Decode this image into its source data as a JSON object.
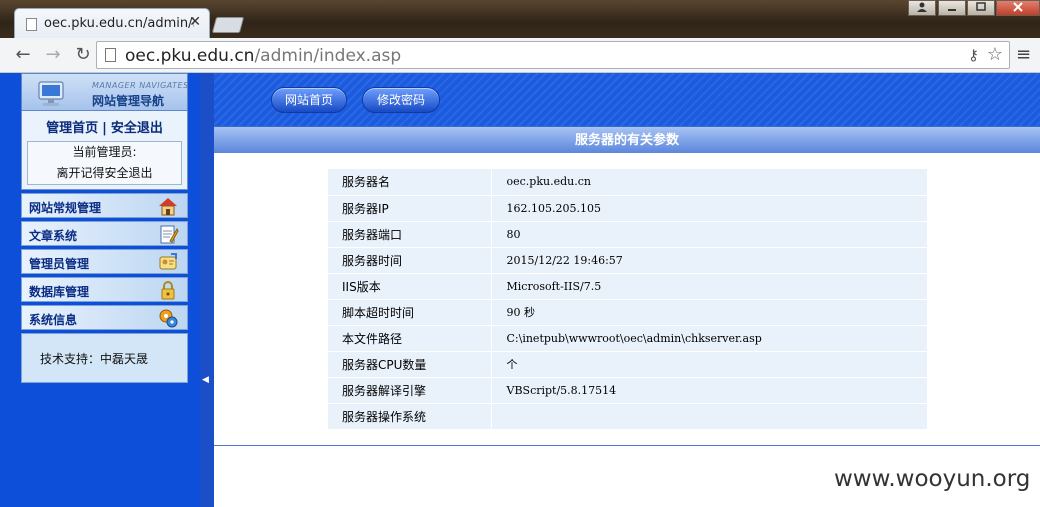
{
  "browser": {
    "tab_title": "oec.pku.edu.cn/admin/i",
    "tab_close": "✕",
    "url_host": "oec.pku.edu.cn",
    "url_path": "/admin/index.asp"
  },
  "sidebar": {
    "nav_subtitle": "MANAGER NAVIGATES",
    "nav_title": "网站管理导航",
    "links": {
      "home": "管理首页",
      "separator": "|",
      "logout": "安全退出"
    },
    "admin_label": "当前管理员:",
    "logout_reminder": "离开记得安全退出",
    "menu": [
      {
        "label": "网站常规管理",
        "icon": "house-icon"
      },
      {
        "label": "文章系统",
        "icon": "notepad-icon"
      },
      {
        "label": "管理员管理",
        "icon": "admin-card-icon"
      },
      {
        "label": "数据库管理",
        "icon": "lock-icon"
      },
      {
        "label": "系统信息",
        "icon": "gears-icon"
      }
    ],
    "support": "技术支持：中磊天晟"
  },
  "topbar": {
    "home_button": "网站首页",
    "password_button": "修改密码"
  },
  "content": {
    "title": "服务器的有关参数",
    "rows": [
      {
        "key": "服务器名",
        "value": "oec.pku.edu.cn"
      },
      {
        "key": "服务器IP",
        "value": "162.105.205.105"
      },
      {
        "key": "服务器端口",
        "value": "80"
      },
      {
        "key": "服务器时间",
        "value": "2015/12/22 19:46:57"
      },
      {
        "key": "IIS版本",
        "value": "Microsoft-IIS/7.5"
      },
      {
        "key": "脚本超时时间",
        "value": "90 秒"
      },
      {
        "key": "本文件路径",
        "value": "C:\\inetpub\\wwwroot\\oec\\admin\\chkserver.asp"
      },
      {
        "key": "服务器CPU数量",
        "value": " 个"
      },
      {
        "key": "服务器解译引擎",
        "value": "VBScript/5.8.17514"
      },
      {
        "key": "服务器操作系统",
        "value": ""
      }
    ]
  },
  "watermark": "www.wooyun.org"
}
